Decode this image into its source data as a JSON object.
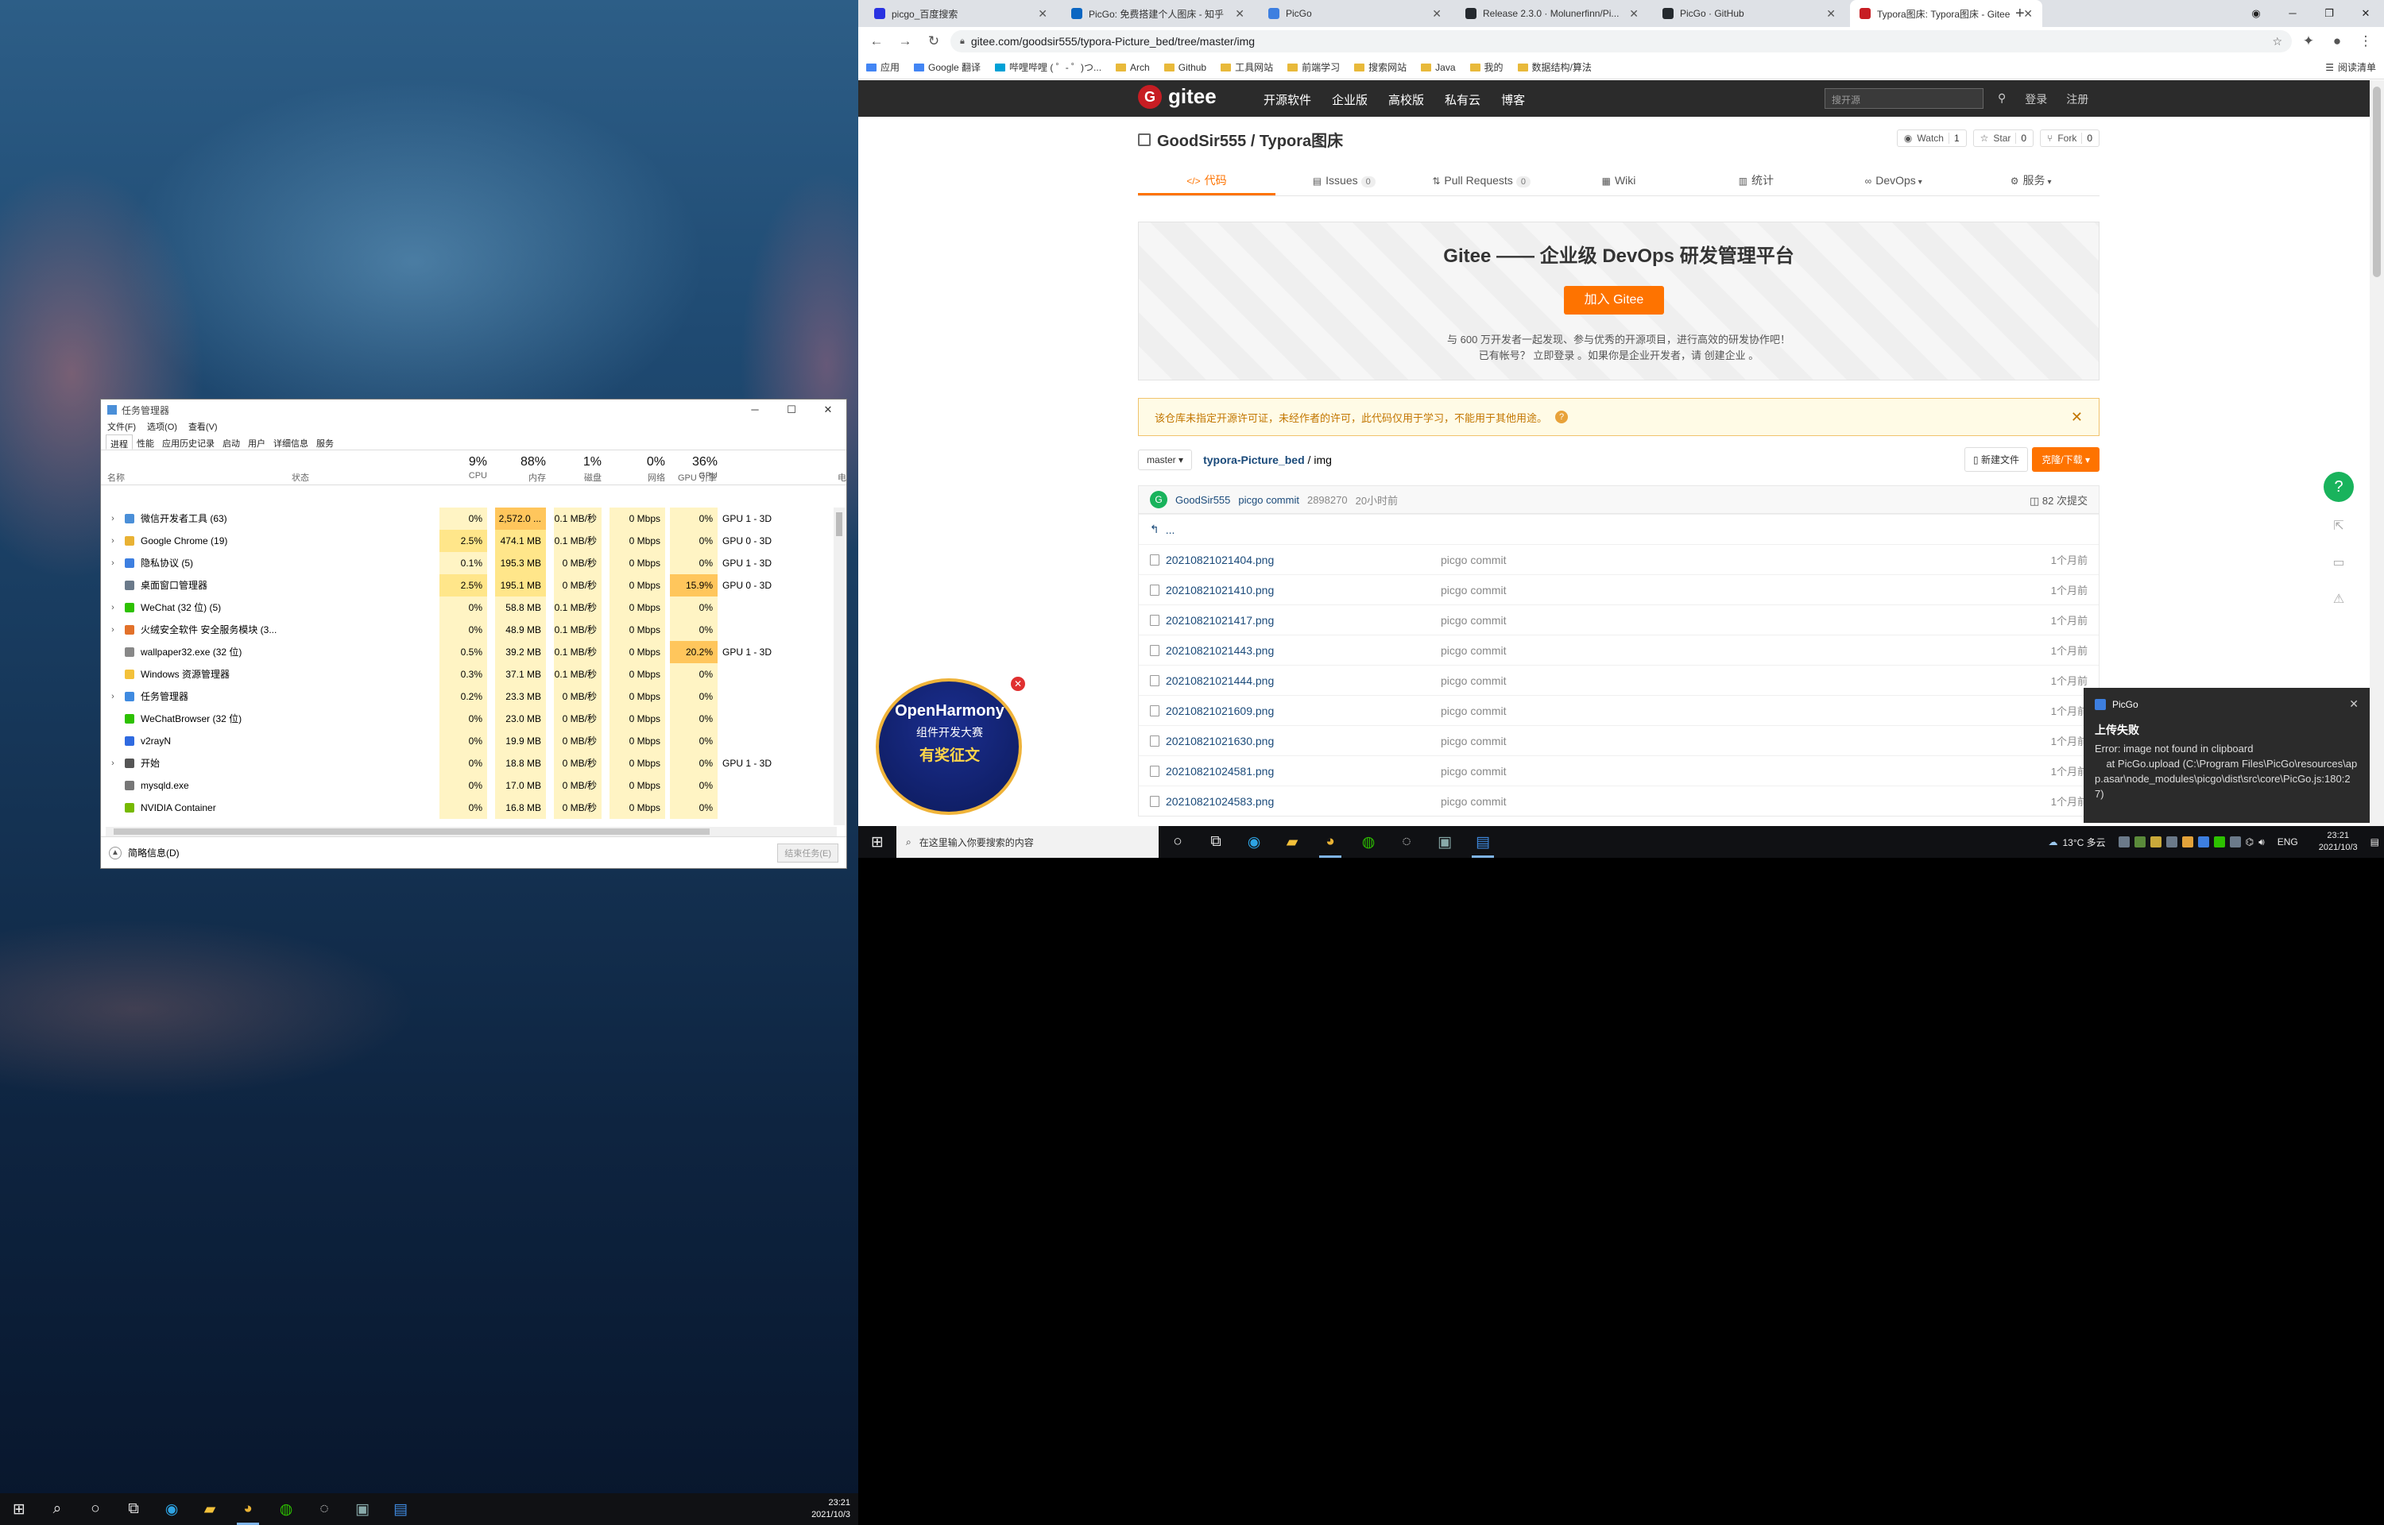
{
  "desktop_left": {
    "taskbar": {
      "time": "23:21",
      "date": "2021/10/3"
    },
    "task_manager": {
      "title": "任务管理器",
      "menu": [
        "文件(F)",
        "选项(O)",
        "查看(V)"
      ],
      "tabs": [
        "进程",
        "性能",
        "应用历史记录",
        "启动",
        "用户",
        "详细信息",
        "服务"
      ],
      "columns": {
        "name": "名称",
        "status": "状态",
        "cpu_pct": "9%",
        "cpu": "CPU",
        "mem_pct": "88%",
        "mem": "内存",
        "disk_pct": "1%",
        "disk": "磁盘",
        "net_pct": "0%",
        "net": "网络",
        "gpu_pct": "36%",
        "gpu": "GPU",
        "gpu_engine": "GPU 引擎",
        "power": "电"
      },
      "processes": [
        {
          "name": "微信开发者工具 (63)",
          "cpu": "0%",
          "mem": "2,572.0 ...",
          "disk": "0.1 MB/秒",
          "net": "0 Mbps",
          "gpu": "0%",
          "engine": "GPU 1 - 3D",
          "exp": true
        },
        {
          "name": "Google Chrome (19)",
          "cpu": "2.5%",
          "mem": "474.1 MB",
          "disk": "0.1 MB/秒",
          "net": "0 Mbps",
          "gpu": "0%",
          "engine": "GPU 0 - 3D",
          "exp": true
        },
        {
          "name": "隐私协议 (5)",
          "cpu": "0.1%",
          "mem": "195.3 MB",
          "disk": "0 MB/秒",
          "net": "0 Mbps",
          "gpu": "0%",
          "engine": "GPU 1 - 3D",
          "exp": true
        },
        {
          "name": "桌面窗口管理器",
          "cpu": "2.5%",
          "mem": "195.1 MB",
          "disk": "0 MB/秒",
          "net": "0 Mbps",
          "gpu": "15.9%",
          "engine": "GPU 0 - 3D",
          "exp": false
        },
        {
          "name": "WeChat (32 位) (5)",
          "cpu": "0%",
          "mem": "58.8 MB",
          "disk": "0.1 MB/秒",
          "net": "0 Mbps",
          "gpu": "0%",
          "engine": "",
          "exp": true
        },
        {
          "name": "火绒安全软件 安全服务模块 (3...",
          "cpu": "0%",
          "mem": "48.9 MB",
          "disk": "0.1 MB/秒",
          "net": "0 Mbps",
          "gpu": "0%",
          "engine": "",
          "exp": true
        },
        {
          "name": "wallpaper32.exe (32 位)",
          "cpu": "0.5%",
          "mem": "39.2 MB",
          "disk": "0.1 MB/秒",
          "net": "0 Mbps",
          "gpu": "20.2%",
          "engine": "GPU 1 - 3D",
          "exp": false
        },
        {
          "name": "Windows 资源管理器",
          "cpu": "0.3%",
          "mem": "37.1 MB",
          "disk": "0.1 MB/秒",
          "net": "0 Mbps",
          "gpu": "0%",
          "engine": "",
          "exp": false
        },
        {
          "name": "任务管理器",
          "cpu": "0.2%",
          "mem": "23.3 MB",
          "disk": "0 MB/秒",
          "net": "0 Mbps",
          "gpu": "0%",
          "engine": "",
          "exp": true
        },
        {
          "name": "WeChatBrowser (32 位)",
          "cpu": "0%",
          "mem": "23.0 MB",
          "disk": "0 MB/秒",
          "net": "0 Mbps",
          "gpu": "0%",
          "engine": "",
          "exp": false
        },
        {
          "name": "v2rayN",
          "cpu": "0%",
          "mem": "19.9 MB",
          "disk": "0 MB/秒",
          "net": "0 Mbps",
          "gpu": "0%",
          "engine": "",
          "exp": false
        },
        {
          "name": "开始",
          "cpu": "0%",
          "mem": "18.8 MB",
          "disk": "0 MB/秒",
          "net": "0 Mbps",
          "gpu": "0%",
          "engine": "GPU 1 - 3D",
          "exp": true
        },
        {
          "name": "mysqld.exe",
          "cpu": "0%",
          "mem": "17.0 MB",
          "disk": "0 MB/秒",
          "net": "0 Mbps",
          "gpu": "0%",
          "engine": "",
          "exp": false
        },
        {
          "name": "NVIDIA Container",
          "cpu": "0%",
          "mem": "16.8 MB",
          "disk": "0 MB/秒",
          "net": "0 Mbps",
          "gpu": "0%",
          "engine": "",
          "exp": false
        }
      ],
      "footer_label": "简略信息(D)",
      "end_task": "结束任务(E)"
    }
  },
  "browser": {
    "tabs": [
      {
        "title": "picgo_百度搜索",
        "color": "#2932e1"
      },
      {
        "title": "PicGo: 免费搭建个人图床 - 知乎",
        "color": "#0a66c2"
      },
      {
        "title": "PicGo",
        "color": "#3d7fe0"
      },
      {
        "title": "Release 2.3.0 · Molunerfinn/Pi...",
        "color": "#24292e"
      },
      {
        "title": "PicGo · GitHub",
        "color": "#24292e"
      },
      {
        "title": "Typora图床: Typora图床 - Gitee",
        "color": "#c71d23"
      }
    ],
    "url": "gitee.com/goodsir555/typora-Picture_bed/tree/master/img",
    "bookmarks": [
      "应用",
      "Google 翻译",
      "哔哩哔哩 ( ゜- ゜)つ...",
      "Arch",
      "Github",
      "工具网站",
      "前端学习",
      "搜索网站",
      "Java",
      "我的",
      "数据结构/算法"
    ],
    "reading_list": "阅读清单"
  },
  "gitee": {
    "logo": "gitee",
    "nav": [
      "开源软件",
      "企业版",
      "高校版",
      "私有云",
      "博客"
    ],
    "search_placeholder": "搜开源",
    "login": "登录",
    "register": "注册",
    "repo_title": "GoodSir555 / Typora图床",
    "watch": {
      "label": "Watch",
      "count": "1"
    },
    "star": {
      "label": "Star",
      "count": "0"
    },
    "fork": {
      "label": "Fork",
      "count": "0"
    },
    "tabs": [
      {
        "label": "代码",
        "count": ""
      },
      {
        "label": "Issues",
        "count": "0"
      },
      {
        "label": "Pull Requests",
        "count": "0"
      },
      {
        "label": "Wiki",
        "count": ""
      },
      {
        "label": "统计",
        "count": ""
      },
      {
        "label": "DevOps",
        "count": ""
      },
      {
        "label": "服务",
        "count": ""
      }
    ],
    "banner_title": "Gitee —— 企业级 DevOps 研发管理平台",
    "banner_button": "加入 Gitee",
    "banner_line1": "与 600 万开发者一起发现、参与优秀的开源项目，进行高效的研发协作吧！",
    "banner_line2": "已有帐号？ 立即登录 。如果你是企业开发者，请 创建企业 。",
    "warning": "该仓库未指定开源许可证，未经作者的许可，此代码仅用于学习，不能用于其他用途。",
    "branch": "master",
    "crumb_repo": "typora-Picture_bed",
    "crumb_dir": "img",
    "new_file": "新建文件",
    "clone": "克隆/下载",
    "commit_author": "GoodSir555",
    "commit_msg": "picgo commit",
    "commit_hash": "2898270",
    "commit_time": "20小时前",
    "commit_count": "82 次提交",
    "parent": "...",
    "files": [
      {
        "name": "20210821021404.png",
        "msg": "picgo commit",
        "time": "1个月前"
      },
      {
        "name": "20210821021410.png",
        "msg": "picgo commit",
        "time": "1个月前"
      },
      {
        "name": "20210821021417.png",
        "msg": "picgo commit",
        "time": "1个月前"
      },
      {
        "name": "20210821021443.png",
        "msg": "picgo commit",
        "time": "1个月前"
      },
      {
        "name": "20210821021444.png",
        "msg": "picgo commit",
        "time": "1个月前"
      },
      {
        "name": "20210821021609.png",
        "msg": "picgo commit",
        "time": "1个月前"
      },
      {
        "name": "20210821021630.png",
        "msg": "picgo commit",
        "time": "1个月前"
      },
      {
        "name": "20210821024581.png",
        "msg": "picgo commit",
        "time": "1个月前"
      },
      {
        "name": "20210821024583.png",
        "msg": "picgo commit",
        "time": "1个月前"
      }
    ]
  },
  "ad": {
    "line1": "OpenHarmony",
    "line2": "组件开发大赛",
    "line3": "有奖征文"
  },
  "toast": {
    "app": "PicGo",
    "title": "上传失败",
    "message": "Error: image not found in clipboard\n    at PicGo.upload (C:\\Program Files\\PicGo\\resources\\app.asar\\node_modules\\picgo\\dist\\src\\core\\PicGo.js:180:27)"
  },
  "taskbar_right": {
    "search_placeholder": "在这里输入你要搜索的内容",
    "weather": "13°C 多云",
    "lang": "ENG",
    "time": "23:21",
    "date": "2021/10/3"
  }
}
